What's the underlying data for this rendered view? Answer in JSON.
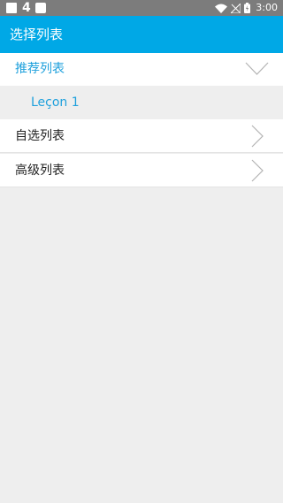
{
  "status_bar": {
    "notification_count": "4",
    "time": "3:00"
  },
  "app_bar": {
    "title": "选择列表"
  },
  "list": {
    "expanded_group": {
      "label": "推荐列表",
      "children": [
        "Leçon 1"
      ]
    },
    "items": [
      {
        "label": "自选列表"
      },
      {
        "label": "高级列表"
      }
    ]
  },
  "colors": {
    "accent": "#00a8e6",
    "accent_text": "#1ea0dc",
    "status_bar": "#7c7c7c",
    "background": "#eeeeee"
  },
  "icons": {
    "expanded": "chevron-down-icon",
    "collapsed": "chevron-right-icon"
  }
}
